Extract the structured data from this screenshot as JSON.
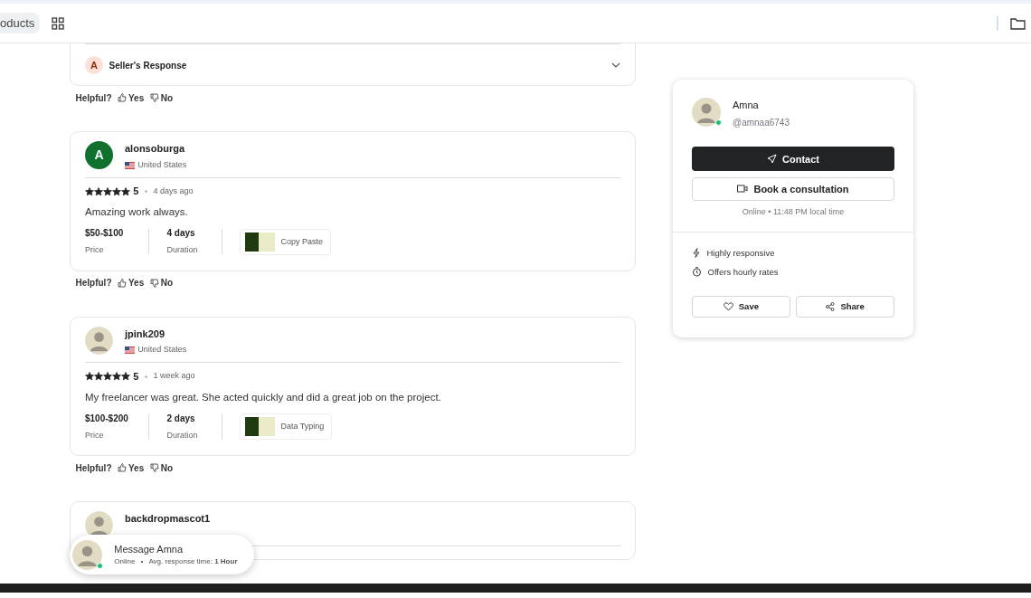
{
  "topbar": {
    "chip": "oducts"
  },
  "partial_review": {
    "response_label": "Seller's Response",
    "response_initial": "A",
    "expanded": false,
    "helpful": {
      "label": "Helpful?",
      "yes": "Yes",
      "no": "No"
    }
  },
  "reviews": [
    {
      "kind": "letter",
      "initial": "A",
      "name": "alonsoburga",
      "country": "United States",
      "stars": 5,
      "rating": "5",
      "time": "4 days ago",
      "text": "Amazing work always.",
      "price": "$50-$100",
      "price_label": "Price",
      "duration": "4 days",
      "duration_label": "Duration",
      "service": "Copy Paste",
      "helpful": {
        "label": "Helpful?",
        "yes": "Yes",
        "no": "No"
      }
    },
    {
      "kind": "photo",
      "name": "jpink209",
      "country": "United States",
      "stars": 5,
      "rating": "5",
      "time": "1 week ago",
      "text": "My freelancer was great. She acted quickly and did a great job on the project.",
      "price": "$100-$200",
      "price_label": "Price",
      "duration": "2 days",
      "duration_label": "Duration",
      "service": "Data Typing",
      "helpful": {
        "label": "Helpful?",
        "yes": "Yes",
        "no": "No"
      }
    },
    {
      "kind": "photo",
      "name": "backdropmascot1"
    }
  ],
  "seller": {
    "name": "Amna",
    "handle": "@amnaa6743",
    "online": true,
    "contact": "Contact",
    "consult": "Book a consultation",
    "status": "Online • 11:48 PM local time",
    "features": [
      {
        "kind": "bolt",
        "label": "Highly responsive"
      },
      {
        "kind": "clock",
        "label": "Offers hourly rates"
      }
    ],
    "save": "Save",
    "share": "Share"
  },
  "message_popup": {
    "title": "Message Amna",
    "status": "Online",
    "response": "Avg. response time: ",
    "response_value": "1 Hour",
    "online": true
  }
}
